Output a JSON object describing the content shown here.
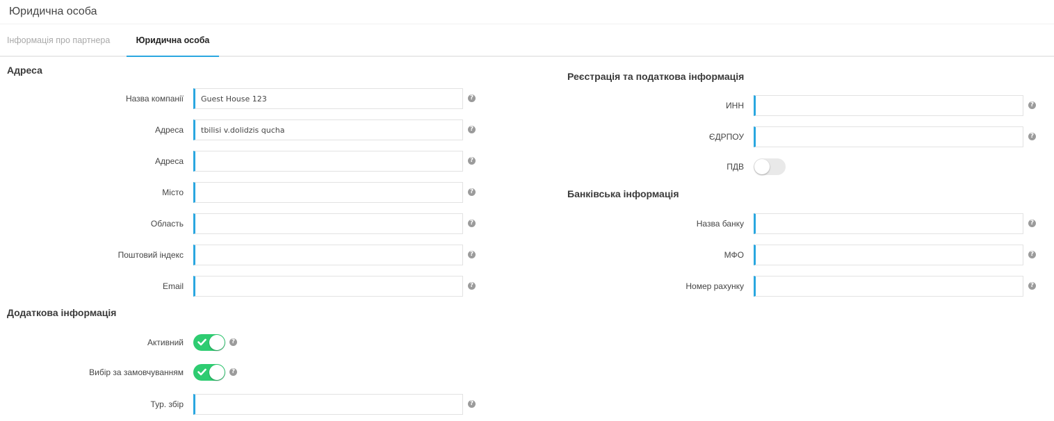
{
  "header": {
    "title": "Юридична особа"
  },
  "tabs": [
    {
      "label": "Інформація про партнера",
      "active": false
    },
    {
      "label": "Юридична особа",
      "active": true
    }
  ],
  "colors": {
    "accent": "#2aa7e0",
    "toggle_on": "#2ecc71",
    "toggle_off": "#e9e9e9"
  },
  "address": {
    "title": "Адреса",
    "fields": [
      {
        "label": "Назва компанії",
        "value": "Guest House 123"
      },
      {
        "label": "Адреса",
        "value": "tbilisi v.dolidzis qucha"
      },
      {
        "label": "Адреса",
        "value": ""
      },
      {
        "label": "Місто",
        "value": ""
      },
      {
        "label": "Область",
        "value": ""
      },
      {
        "label": "Поштовий індекс",
        "value": ""
      },
      {
        "label": "Email",
        "value": ""
      }
    ]
  },
  "extra": {
    "title": "Додаткова інформація",
    "active_label": "Активний",
    "active_on": true,
    "default_label": "Вибір за замовчуванням",
    "default_on": true,
    "tax_label": "Тур. збір",
    "tax_value": ""
  },
  "registration": {
    "title": "Реєстрація та податкова інформація",
    "fields": [
      {
        "label": "ИНН",
        "value": ""
      },
      {
        "label": "ЄДРПОУ",
        "value": ""
      }
    ],
    "vat_label": "ПДВ",
    "vat_on": false
  },
  "bank": {
    "title": "Банківська інформація",
    "fields": [
      {
        "label": "Назва банку",
        "value": ""
      },
      {
        "label": "МФО",
        "value": ""
      },
      {
        "label": "Номер рахунку",
        "value": ""
      }
    ]
  },
  "help_glyph": "?"
}
